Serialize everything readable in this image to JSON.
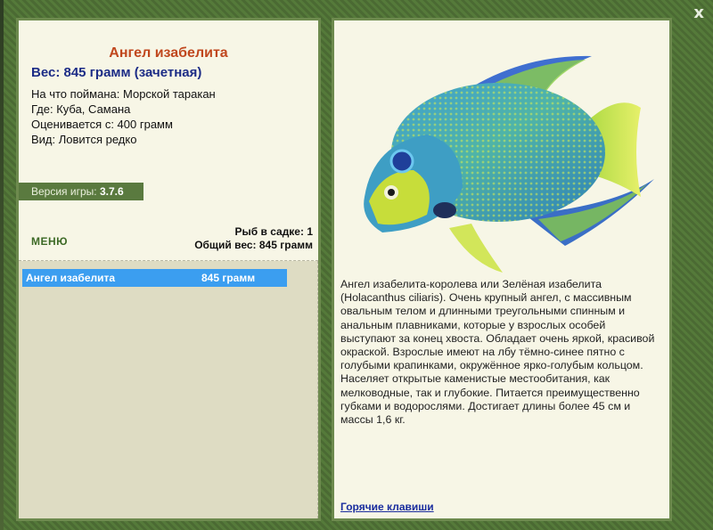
{
  "window": {
    "close_label": "x"
  },
  "fish_card": {
    "title": "Ангел изабелита",
    "weight_line": "Вес: 845 грамм (зачетная)",
    "info": [
      "На что поймана: Морской таракан",
      "Где: Куба, Самана",
      "Оценивается с: 400 грамм",
      "Вид: Ловится редко"
    ]
  },
  "version": {
    "label": "Версия игры:",
    "value": "3.7.6"
  },
  "menu": {
    "label": "МЕНЮ"
  },
  "cage": {
    "count_line": "Рыб в садке: 1",
    "total_line": "Общий вес: 845 грамм"
  },
  "catch_list": [
    {
      "name": "Ангел изабелита",
      "weight": "845 грамм"
    }
  ],
  "description": {
    "text": "Ангел изабелита-королева или Зелёная изабелита (Holacanthus ciliaris). Очень крупный ангел, с массивным овальным телом и длинными треугольными спинным и анальным плавниками, которые у взрослых особей выступают за конец хвоста. Обладает очень яркой, красивой окраской. Взрослые имеют на лбу тёмно-синее пятно с голубыми крапинками, окружённое ярко-голубым кольцом. Населяет открытые каменистые местообитания, как мелководные, так и глубокие. Питается преимущественно губками и водорослями. Достигает длины более 45 см и массы 1,6 кг."
  },
  "hotkeys": {
    "label": "Горячие клавиши"
  },
  "icons": {
    "close": "close-icon",
    "fish": "fish-illustration"
  },
  "colors": {
    "title": "#c0471d",
    "weight": "#1c2c86",
    "selection": "#3b9ef0",
    "panel_bg": "#f7f6e6",
    "frame": "#557a3a"
  }
}
